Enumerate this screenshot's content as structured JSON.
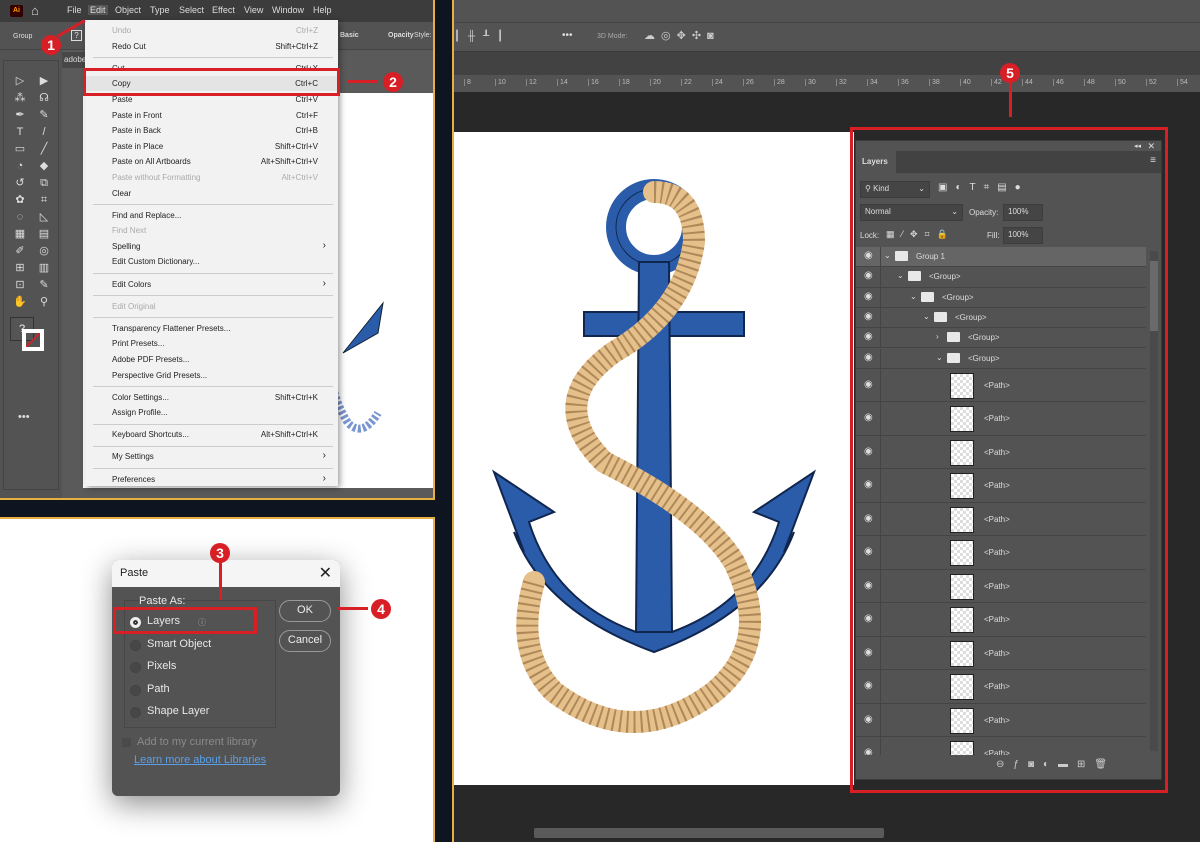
{
  "illustrator": {
    "logo": "Ai",
    "menu": [
      "File",
      "Edit",
      "Object",
      "Type",
      "Select",
      "Effect",
      "View",
      "Window",
      "Help"
    ],
    "control_bar": {
      "selection": "Group",
      "help": "?",
      "stroke_style": "Basic",
      "opacity_label": "Opacity",
      "style_label": "Style:"
    },
    "doc_tab": "adobe",
    "edit_menu": [
      {
        "label": "Undo",
        "shortcut": "Ctrl+Z",
        "disabled": true
      },
      {
        "label": "Redo Cut",
        "shortcut": "Shift+Ctrl+Z"
      },
      {
        "sep": true
      },
      {
        "label": "Cut",
        "shortcut": "Ctrl+X"
      },
      {
        "label": "Copy",
        "shortcut": "Ctrl+C",
        "highlight": true
      },
      {
        "label": "Paste",
        "shortcut": "Ctrl+V"
      },
      {
        "label": "Paste in Front",
        "shortcut": "Ctrl+F"
      },
      {
        "label": "Paste in Back",
        "shortcut": "Ctrl+B"
      },
      {
        "label": "Paste in Place",
        "shortcut": "Shift+Ctrl+V"
      },
      {
        "label": "Paste on All Artboards",
        "shortcut": "Alt+Shift+Ctrl+V"
      },
      {
        "label": "Paste without Formatting",
        "shortcut": "Alt+Ctrl+V",
        "disabled": true
      },
      {
        "label": "Clear",
        "shortcut": ""
      },
      {
        "sep": true
      },
      {
        "label": "Find and Replace...",
        "shortcut": ""
      },
      {
        "label": "Find Next",
        "shortcut": "",
        "disabled": true
      },
      {
        "label": "Spelling",
        "shortcut": "",
        "submenu": true
      },
      {
        "label": "Edit Custom Dictionary...",
        "shortcut": ""
      },
      {
        "sep": true
      },
      {
        "label": "Edit Colors",
        "shortcut": "",
        "submenu": true
      },
      {
        "sep": true
      },
      {
        "label": "Edit Original",
        "shortcut": "",
        "disabled": true
      },
      {
        "sep": true
      },
      {
        "label": "Transparency Flattener Presets...",
        "shortcut": ""
      },
      {
        "label": "Print Presets...",
        "shortcut": ""
      },
      {
        "label": "Adobe PDF Presets...",
        "shortcut": ""
      },
      {
        "label": "Perspective Grid Presets...",
        "shortcut": ""
      },
      {
        "sep": true
      },
      {
        "label": "Color Settings...",
        "shortcut": "Shift+Ctrl+K"
      },
      {
        "label": "Assign Profile...",
        "shortcut": ""
      },
      {
        "sep": true
      },
      {
        "label": "Keyboard Shortcuts...",
        "shortcut": "Alt+Shift+Ctrl+K"
      },
      {
        "sep": true
      },
      {
        "label": "My Settings",
        "shortcut": "",
        "submenu": true
      },
      {
        "sep": true
      },
      {
        "label": "Preferences",
        "shortcut": "",
        "submenu": true
      }
    ],
    "submenu_glyph": "›"
  },
  "steps": [
    "1",
    "2",
    "3",
    "4",
    "5"
  ],
  "paste_dialog": {
    "title": "Paste",
    "close": "✕",
    "group_label": "Paste As:",
    "options": [
      {
        "label": "Layers",
        "selected": true
      },
      {
        "label": "Smart Object",
        "selected": false
      },
      {
        "label": "Pixels",
        "selected": false
      },
      {
        "label": "Path",
        "selected": false
      },
      {
        "label": "Shape Layer",
        "selected": false
      }
    ],
    "info_glyph": "ⓘ",
    "ok": "OK",
    "cancel": "Cancel",
    "library_checkbox": "Add to my current library",
    "library_link": "Learn more about Libraries"
  },
  "photoshop": {
    "options_bar": {
      "more": "•••",
      "mode_label": "3D Mode:"
    },
    "ruler": [
      "8",
      "10",
      "12",
      "14",
      "16",
      "18",
      "20",
      "22",
      "24",
      "26",
      "28",
      "30",
      "32",
      "34",
      "36",
      "38",
      "40",
      "42",
      "44",
      "46",
      "48",
      "50",
      "52",
      "54"
    ],
    "layers_panel": {
      "tab": "Layers",
      "filter_kind": "Kind",
      "blend_mode": "Normal",
      "opacity_label": "Opacity:",
      "opacity": "100%",
      "lock_label": "Lock:",
      "fill_label": "Fill:",
      "fill": "100%",
      "layers": [
        {
          "name": "Group 1",
          "type": "group",
          "depth": 0,
          "expanded": true,
          "selected": true
        },
        {
          "name": "<Group>",
          "type": "group",
          "depth": 1,
          "expanded": true
        },
        {
          "name": "<Group>",
          "type": "group",
          "depth": 2,
          "expanded": true
        },
        {
          "name": "<Group>",
          "type": "group",
          "depth": 3,
          "expanded": true
        },
        {
          "name": "<Group>",
          "type": "group",
          "depth": 4,
          "expanded": false
        },
        {
          "name": "<Group>",
          "type": "group",
          "depth": 4,
          "expanded": true
        },
        {
          "name": "<Path>",
          "type": "path"
        },
        {
          "name": "<Path>",
          "type": "path"
        },
        {
          "name": "<Path>",
          "type": "path"
        },
        {
          "name": "<Path>",
          "type": "path"
        },
        {
          "name": "<Path>",
          "type": "path"
        },
        {
          "name": "<Path>",
          "type": "path"
        },
        {
          "name": "<Path>",
          "type": "path"
        },
        {
          "name": "<Path>",
          "type": "path"
        },
        {
          "name": "<Path>",
          "type": "path"
        },
        {
          "name": "<Path>",
          "type": "path"
        },
        {
          "name": "<Path>",
          "type": "path"
        },
        {
          "name": "<Path>",
          "type": "path"
        }
      ],
      "footer_icons": [
        "link-icon",
        "fx-icon",
        "mask-icon",
        "adjustment-icon",
        "folder-icon",
        "new-layer-icon",
        "trash-icon"
      ]
    }
  },
  "colors": {
    "highlight": "#d81f26",
    "frame": "#e8b040",
    "anchor_blue": "#2a5caa",
    "rope": "#e6c08a"
  }
}
